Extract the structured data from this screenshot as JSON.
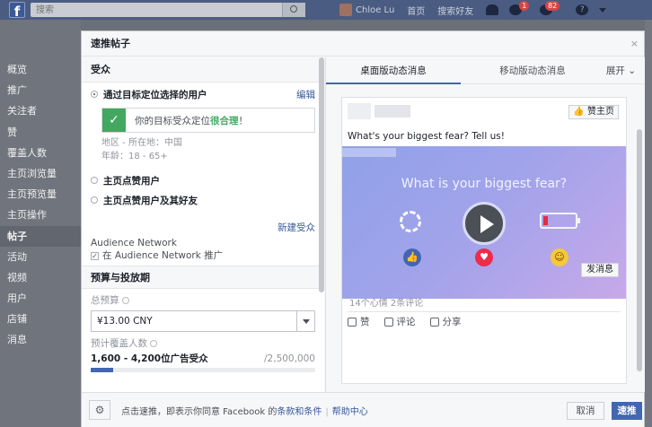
{
  "topbar": {
    "search_placeholder": "搜索",
    "user_name": "Chloe Lu",
    "home": "首页",
    "find_friends": "搜索好友",
    "msg_badge": "1",
    "notif_badge": "82",
    "help": "?"
  },
  "left_nav": {
    "items": [
      "概览",
      "推广",
      "关注者",
      "赞",
      "覆盖人数",
      "主页浏览量",
      "主页预览量",
      "主页操作",
      "帖子",
      "活动",
      "视频",
      "用户",
      "店铺",
      "消息"
    ],
    "active": "帖子"
  },
  "modal": {
    "title": "速推帖子",
    "close": "×"
  },
  "audience": {
    "section_title": "受众",
    "option1": "通过目标定位选择的用户",
    "edit": "编辑",
    "target_msg_prefix": "你的目标受众定位",
    "target_msg_bold": "很合理",
    "target_msg_suffix": "！",
    "location": "地区 - 所在地：中国",
    "age": "年龄：18 - 65+",
    "option2": "主页点赞用户",
    "option3": "主页点赞用户及其好友",
    "new_audience": "新建受众",
    "network_title": "Audience Network",
    "network_check": "在 Audience Network 推广"
  },
  "budget": {
    "section_title": "预算与投放期",
    "total_label": "总预算",
    "total_value": "¥13.00 CNY",
    "reach_label": "预计覆盖人数",
    "reach_value": "1,600 - 4,200位广告受众",
    "reach_max": "/2,500,000",
    "reach_fraction": 0.1
  },
  "preview": {
    "tab_desktop": "桌面版动态消息",
    "tab_mobile": "移动版动态消息",
    "expand": "展开",
    "like_page": "赞主页",
    "post_text": "What's your biggest fear? Tell us!",
    "image_title": "What is your biggest fear?",
    "send_message": "发消息",
    "stats": "14个心情  2条评论",
    "action_like": "赞",
    "action_comment": "评论",
    "action_share": "分享"
  },
  "footer": {
    "gear": "⚙",
    "text_prefix": "点击速推，即表示你同意 Facebook 的",
    "terms_link": "条款和条件",
    "sep": "|",
    "help_link": "帮助中心",
    "cancel": "取消",
    "boost": "速推"
  },
  "colors": {
    "accent": "#4267b2",
    "success": "#42a85f",
    "badge": "#d84545"
  }
}
